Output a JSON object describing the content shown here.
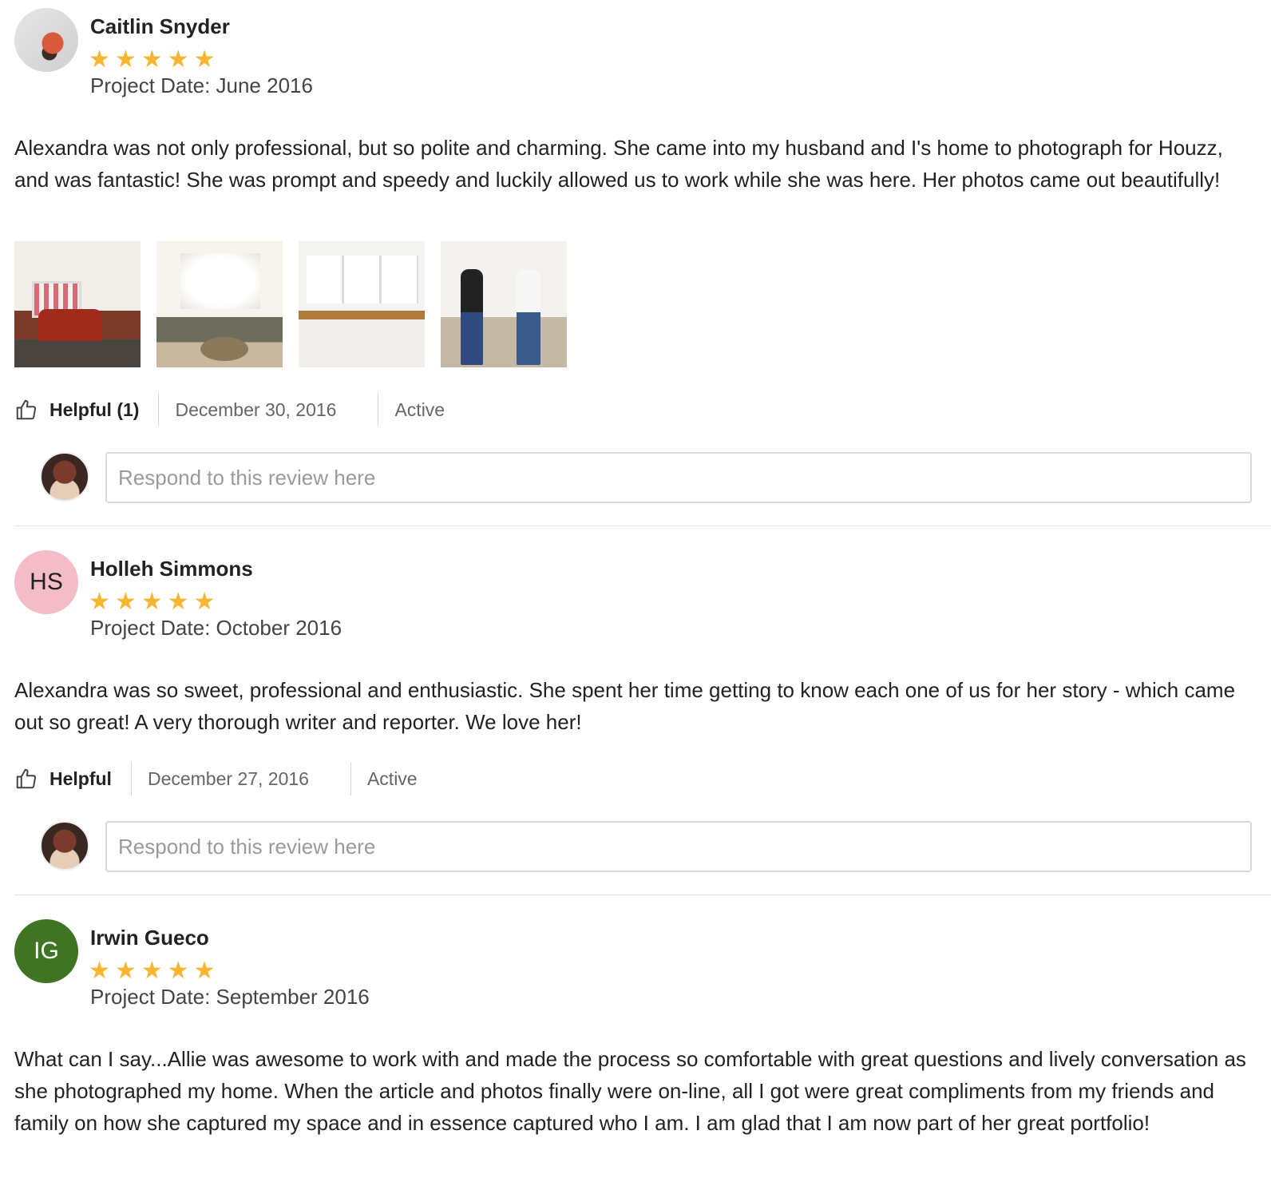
{
  "reviews": [
    {
      "name": "Caitlin Snyder",
      "avatar_type": "photo",
      "rating": 5,
      "project_date": "Project Date: June 2016",
      "text": "Alexandra was not only professional, but so polite and charming. She came into my husband and I's home to photograph for Houzz, and was fantastic! She was prompt and speedy and luckily allowed us to work while she was here. Her photos came out beautifully!",
      "photo_count": 4,
      "helpful_label": "Helpful (1)",
      "date": "December 30, 2016",
      "status": "Active",
      "respond_placeholder": "Respond to this review here"
    },
    {
      "name": "Holleh Simmons",
      "initials": "HS",
      "avatar_color": "#f3bcc7",
      "rating": 5,
      "project_date": "Project Date: October 2016",
      "text": "Alexandra was so sweet, professional and enthusiastic. She spent her time getting to know each one of us for her story - which came out so great! A very thorough writer and reporter. We love her!",
      "helpful_label": "Helpful",
      "date": "December 27, 2016",
      "status": "Active",
      "respond_placeholder": "Respond to this review here"
    },
    {
      "name": "Irwin Gueco",
      "initials": "IG",
      "avatar_color": "#3f7423",
      "rating": 5,
      "project_date": "Project Date: September 2016",
      "text": "What can I say...Allie was awesome to work with and made the process so comfortable with great questions and lively conversation as she photographed my home. When the article and photos finally were on-line, all I got were great compliments from my friends and family on how she captured my space and in essence captured who I am. I am glad that I am now part of her great portfolio!"
    }
  ],
  "icons": {
    "star": "star-icon",
    "helpful": "thumbs-up-icon"
  },
  "colors": {
    "star": "#f6b632",
    "divider": "#e3e3e3"
  }
}
